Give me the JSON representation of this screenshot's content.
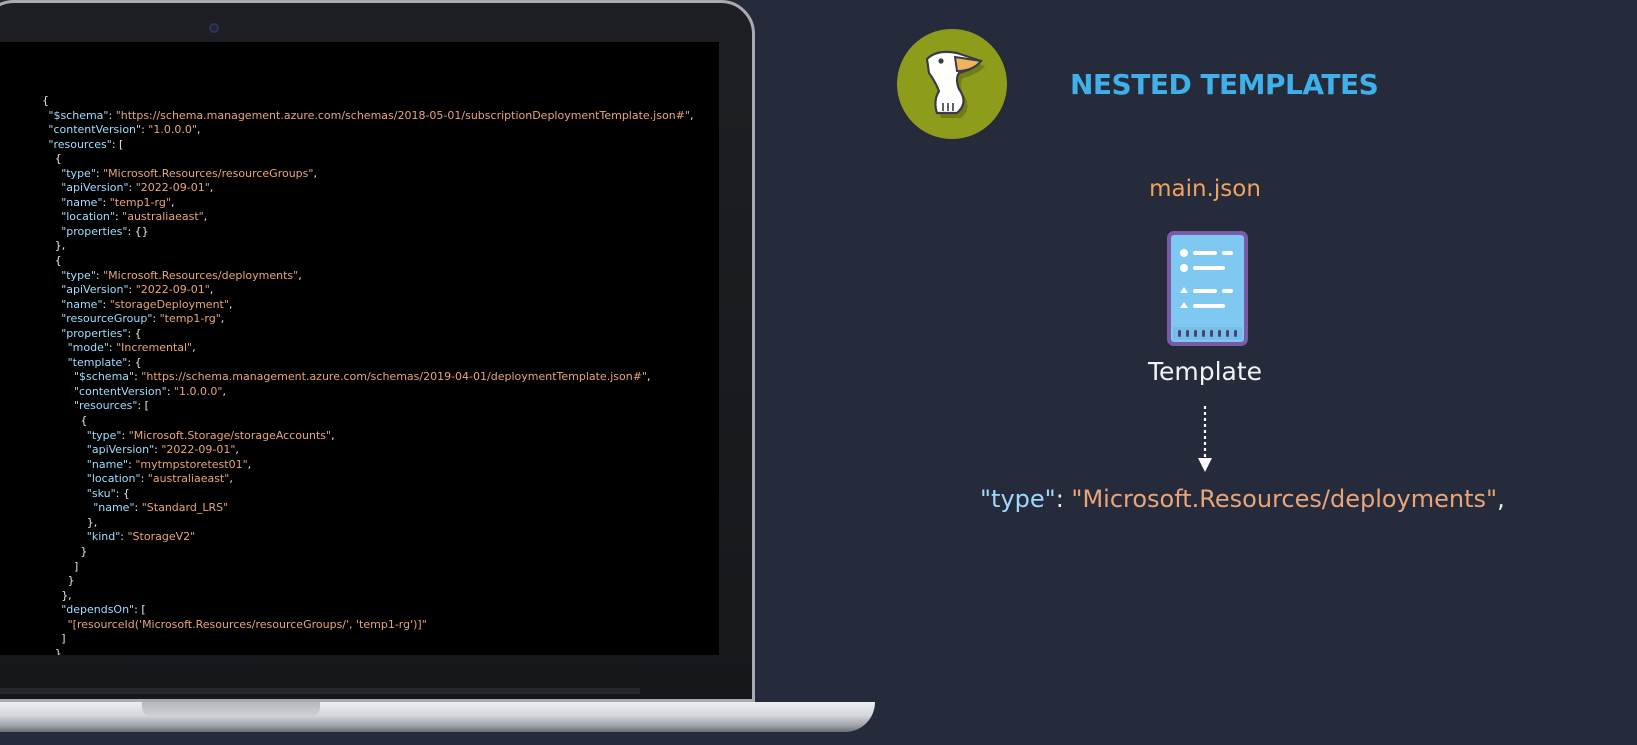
{
  "heading": "NESTED TEMPLATES",
  "file_label": "main.json",
  "doc_label": "Template",
  "type_line": {
    "key": "\"type\"",
    "colon": ": ",
    "value": "\"Microsoft.Resources/deployments\"",
    "trailing": ","
  },
  "icons": {
    "logo": "pelican-logo-icon",
    "document": "template-document-icon",
    "arrow": "dotted-arrow-down-icon"
  },
  "colors": {
    "background": "#262b3b",
    "heading": "#3fb0ea",
    "file_label": "#f0a35b",
    "json_key": "#9fd8ff",
    "json_string": "#e8a57a",
    "logo_circle": "#8e9c1c"
  },
  "code_lines": [
    {
      "i": 0,
      "k": "",
      "s": "",
      "p": "{"
    },
    {
      "i": 1,
      "k": "\"$schema\"",
      "s": "\"https://schema.management.azure.com/schemas/2018-05-01/subscriptionDeploymentTemplate.json#\"",
      "p": ","
    },
    {
      "i": 1,
      "k": "\"contentVersion\"",
      "s": "\"1.0.0.0\"",
      "p": ","
    },
    {
      "i": 1,
      "k": "\"resources\"",
      "s": "",
      "p": "["
    },
    {
      "i": 2,
      "k": "",
      "s": "",
      "p": "{"
    },
    {
      "i": 3,
      "k": "\"type\"",
      "s": "\"Microsoft.Resources/resourceGroups\"",
      "p": ","
    },
    {
      "i": 3,
      "k": "\"apiVersion\"",
      "s": "\"2022-09-01\"",
      "p": ","
    },
    {
      "i": 3,
      "k": "\"name\"",
      "s": "\"temp1-rg\"",
      "p": ","
    },
    {
      "i": 3,
      "k": "\"location\"",
      "s": "\"australiaeast\"",
      "p": ","
    },
    {
      "i": 3,
      "k": "\"properties\"",
      "s": "",
      "p": "{}"
    },
    {
      "i": 2,
      "k": "",
      "s": "",
      "p": "},"
    },
    {
      "i": 2,
      "k": "",
      "s": "",
      "p": "{"
    },
    {
      "i": 3,
      "k": "\"type\"",
      "s": "\"Microsoft.Resources/deployments\"",
      "p": ","
    },
    {
      "i": 3,
      "k": "\"apiVersion\"",
      "s": "\"2022-09-01\"",
      "p": ","
    },
    {
      "i": 3,
      "k": "\"name\"",
      "s": "\"storageDeployment\"",
      "p": ","
    },
    {
      "i": 3,
      "k": "\"resourceGroup\"",
      "s": "\"temp1-rg\"",
      "p": ","
    },
    {
      "i": 3,
      "k": "\"properties\"",
      "s": "",
      "p": "{"
    },
    {
      "i": 4,
      "k": "\"mode\"",
      "s": "\"Incremental\"",
      "p": ","
    },
    {
      "i": 4,
      "k": "\"template\"",
      "s": "",
      "p": "{"
    },
    {
      "i": 5,
      "k": "\"$schema\"",
      "s": "\"https://schema.management.azure.com/schemas/2019-04-01/deploymentTemplate.json#\"",
      "p": ","
    },
    {
      "i": 5,
      "k": "\"contentVersion\"",
      "s": "\"1.0.0.0\"",
      "p": ","
    },
    {
      "i": 5,
      "k": "\"resources\"",
      "s": "",
      "p": "["
    },
    {
      "i": 6,
      "k": "",
      "s": "",
      "p": "{"
    },
    {
      "i": 7,
      "k": "\"type\"",
      "s": "\"Microsoft.Storage/storageAccounts\"",
      "p": ","
    },
    {
      "i": 7,
      "k": "\"apiVersion\"",
      "s": "\"2022-09-01\"",
      "p": ","
    },
    {
      "i": 7,
      "k": "\"name\"",
      "s": "\"mytmpstoretest01\"",
      "p": ","
    },
    {
      "i": 7,
      "k": "\"location\"",
      "s": "\"australiaeast\"",
      "p": ","
    },
    {
      "i": 7,
      "k": "\"sku\"",
      "s": "",
      "p": "{"
    },
    {
      "i": 8,
      "k": "\"name\"",
      "s": "\"Standard_LRS\"",
      "p": ""
    },
    {
      "i": 7,
      "k": "",
      "s": "",
      "p": "},"
    },
    {
      "i": 7,
      "k": "\"kind\"",
      "s": "\"StorageV2\"",
      "p": ""
    },
    {
      "i": 6,
      "k": "",
      "s": "",
      "p": "}"
    },
    {
      "i": 5,
      "k": "",
      "s": "",
      "p": "]"
    },
    {
      "i": 4,
      "k": "",
      "s": "",
      "p": "}"
    },
    {
      "i": 3,
      "k": "",
      "s": "",
      "p": "},"
    },
    {
      "i": 3,
      "k": "\"dependsOn\"",
      "s": "",
      "p": "["
    },
    {
      "i": 4,
      "k": "",
      "s": "\"[resourceId('Microsoft.Resources/resourceGroups/', 'temp1-rg')]\"",
      "p": ""
    },
    {
      "i": 3,
      "k": "",
      "s": "",
      "p": "]"
    },
    {
      "i": 2,
      "k": "",
      "s": "",
      "p": "}"
    },
    {
      "i": 1,
      "k": "",
      "s": "",
      "p": "]"
    },
    {
      "i": 0,
      "k": "",
      "s": "",
      "p": "}"
    }
  ]
}
